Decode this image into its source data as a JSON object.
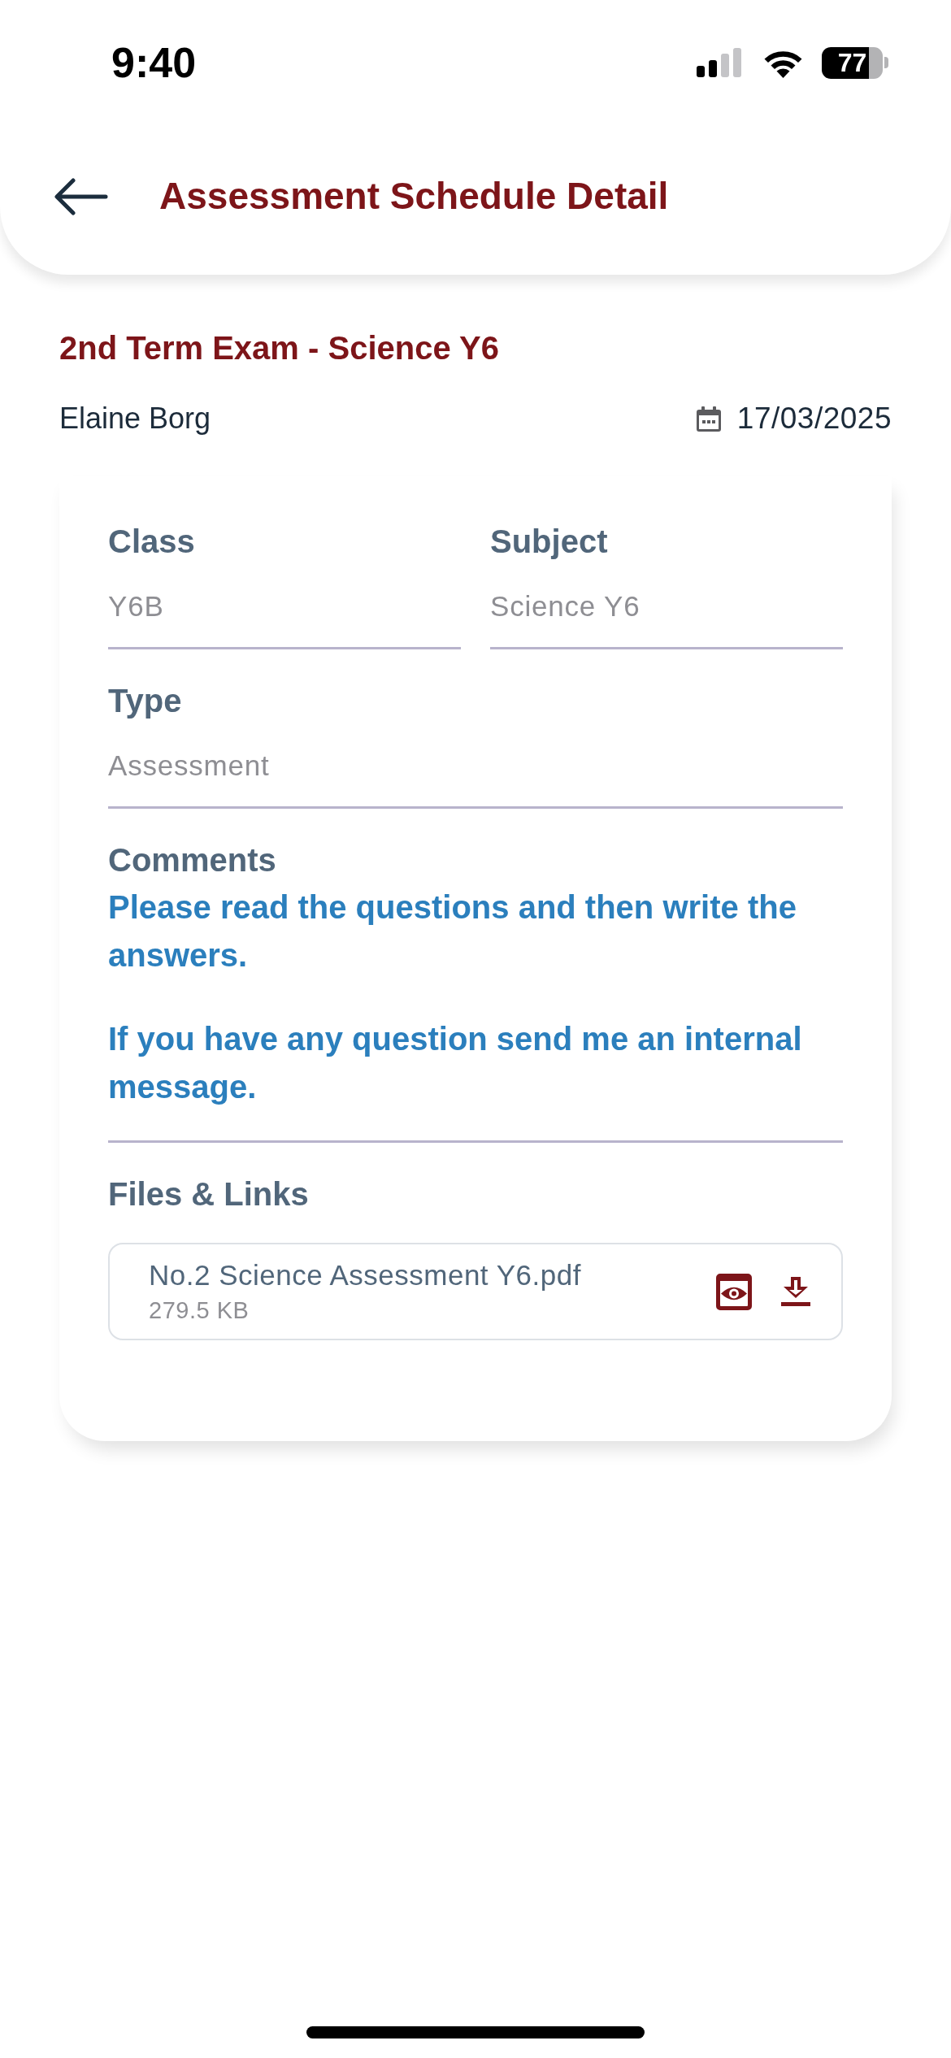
{
  "status_bar": {
    "time": "9:40",
    "battery": "77"
  },
  "header": {
    "title": "Assessment Schedule Detail"
  },
  "assessment": {
    "title": "2nd Term Exam - Science Y6",
    "teacher": "Elaine Borg",
    "date": "17/03/2025"
  },
  "field_rows": [
    [
      {
        "label": "Class",
        "value": "Y6B"
      },
      {
        "label": "Subject",
        "value": "Science Y6"
      }
    ],
    [
      {
        "label": "Type",
        "value": "Assessment"
      }
    ]
  ],
  "comments": {
    "label": "Comments",
    "paragraphs": [
      "Please read the questions and then write the answers.",
      "If you have any question send me an internal message."
    ]
  },
  "files": {
    "label": "Files & Links",
    "items": [
      {
        "name": "No.2 Science Assessment Y6.pdf",
        "size": "279.5 KB"
      }
    ]
  }
}
